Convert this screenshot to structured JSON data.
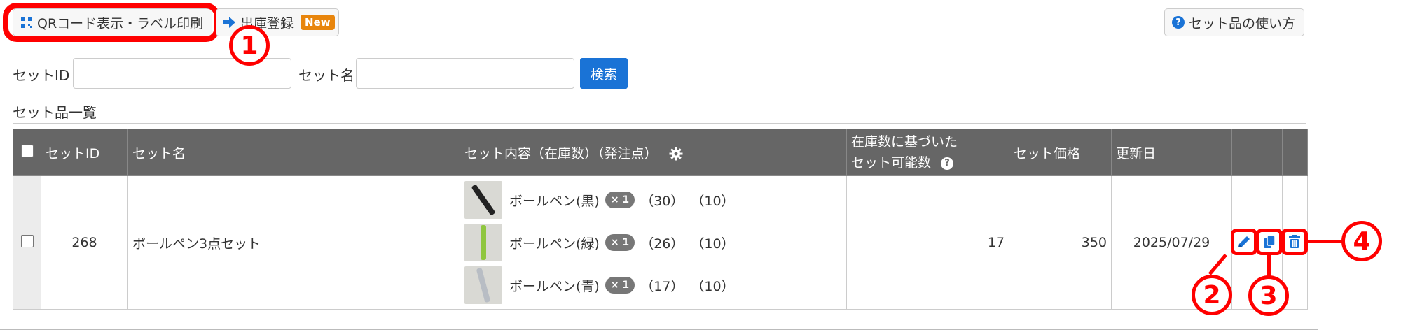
{
  "toolbar": {
    "qr_label": "QRコード表示・ラベル印刷",
    "shipment_label": "出庫登録",
    "new_badge": "New",
    "help_label": "セット品の使い方"
  },
  "search": {
    "set_id_label": "セットID",
    "set_name_label": "セット名",
    "button": "検索"
  },
  "list_title": "セット品一覧",
  "table": {
    "headers": {
      "set_id": "セットID",
      "set_name": "セット名",
      "contents": "セット内容（在庫数）（発注点）",
      "possible_1": "在庫数に基づいた",
      "possible_2": "セット可能数",
      "price": "セット価格",
      "updated": "更新日"
    },
    "rows": [
      {
        "set_id": "268",
        "set_name": "ボールペン3点セット",
        "items": [
          {
            "name": "ボールペン(黒)",
            "qty": "× 1",
            "stock": "（30）",
            "reorder": "（10）",
            "pen_color": "#222222"
          },
          {
            "name": "ボールペン(緑)",
            "qty": "× 1",
            "stock": "（26）",
            "reorder": "（10）",
            "pen_color": "#8fc63f"
          },
          {
            "name": "ボールペン(青)",
            "qty": "× 1",
            "stock": "（17）",
            "reorder": "（10）",
            "pen_color": "#b8bdc4"
          }
        ],
        "possible": "17",
        "price": "350",
        "updated": "2025/07/29"
      }
    ]
  },
  "callouts": {
    "c1": "1",
    "c2": "2",
    "c3": "3",
    "c4": "4"
  },
  "colors": {
    "accent": "#1a73d6",
    "highlight": "#ff0000",
    "header_bg": "#666666",
    "new_badge": "#e8850c"
  }
}
